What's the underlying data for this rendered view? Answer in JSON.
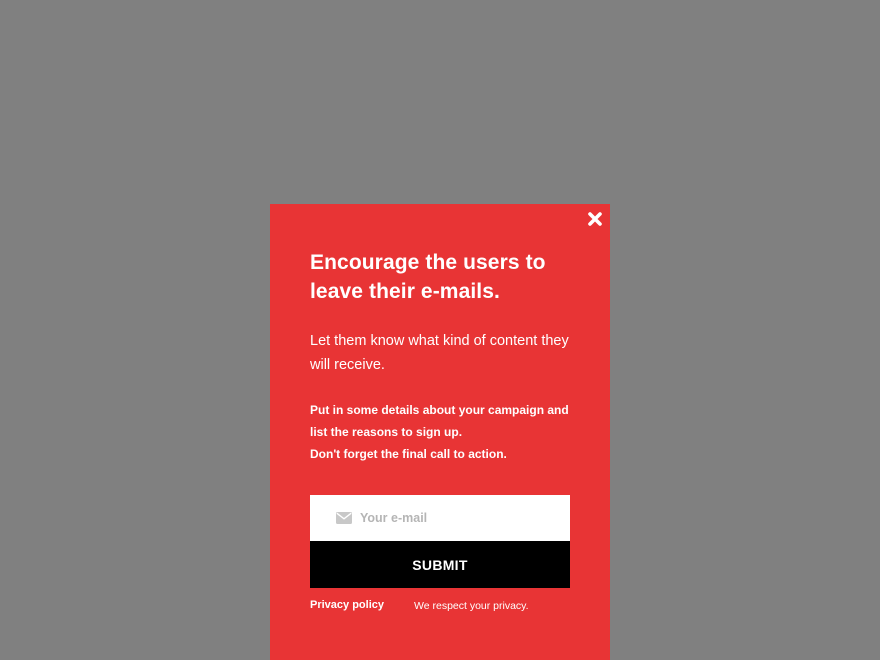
{
  "popup": {
    "close_icon": "close-icon",
    "headline": "Encourage the users to leave their e-mails.",
    "subhead": "Let them know what kind of content they will receive.",
    "details_line1": "Put in some details about your campaign and list the reasons to sign up.",
    "details_line2_prefix": "Don't forget the final ",
    "details_line2_cta": "call to action.",
    "email": {
      "icon": "envelope-icon",
      "placeholder": "Your e-mail",
      "value": ""
    },
    "submit_label": "SUBMIT",
    "privacy_link": "Privacy policy",
    "privacy_note": "We respect your privacy."
  },
  "colors": {
    "background_overlay": "#808080",
    "popup_background": "#e83435",
    "button_background": "#000000",
    "text": "#ffffff"
  }
}
